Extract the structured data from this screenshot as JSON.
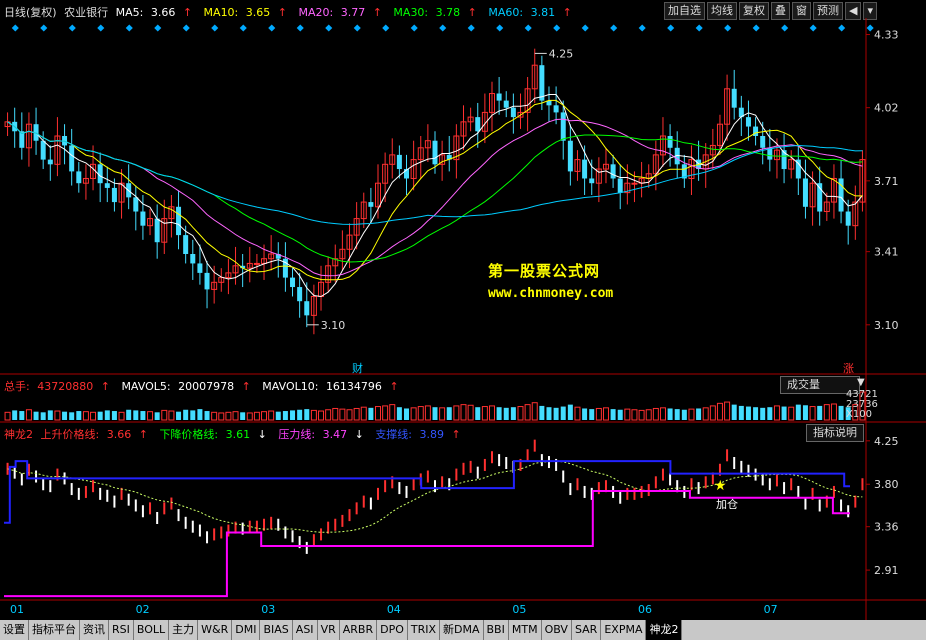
{
  "header": {
    "period": "日线(复权)",
    "stock": "农业银行",
    "ma5": {
      "label": "MA5:",
      "value": "3.66",
      "arrow": "↑",
      "color": "#ffffff"
    },
    "ma10": {
      "label": "MA10:",
      "value": "3.65",
      "arrow": "↑",
      "color": "#ffff00"
    },
    "ma20": {
      "label": "MA20:",
      "value": "3.77",
      "arrow": "↑",
      "color": "#ff66ff"
    },
    "ma30": {
      "label": "MA30:",
      "value": "3.78",
      "arrow": "↑",
      "color": "#00ff00"
    },
    "ma60": {
      "label": "MA60:",
      "value": "3.81",
      "arrow": "↑",
      "color": "#00ccff"
    }
  },
  "toolbar": {
    "add": "加自选",
    "ma": "均线",
    "adj": "复权",
    "overlay": "叠",
    "window": "窗",
    "forecast": "预测",
    "sound": "◀",
    "menu": "▾"
  },
  "watermark": {
    "line1": "第一股票公式网",
    "line2": "www.chnmoney.com"
  },
  "markers": {
    "cai": "财",
    "zhang": "涨"
  },
  "vol_header": {
    "label": "总手:",
    "value": "43720880",
    "arrow": "↑",
    "mavol5_label": "MAVOL5:",
    "mavol5": "20007978",
    "mavol5_arrow": "↑",
    "mavol10_label": "MAVOL10:",
    "mavol10": "16134796",
    "mavol10_arrow": "↑"
  },
  "vol_selector": "成交量",
  "vol_axis": {
    "top": "43721",
    "mid": "23736",
    "unit": "X100"
  },
  "ind_header": {
    "name": "神龙2",
    "l1_label": "上升价格线:",
    "l1": "3.66",
    "l1_arrow": "↑",
    "l2_label": "下降价格线:",
    "l2": "3.61",
    "l2_arrow": "↓",
    "l3_label": "压力线:",
    "l3": "3.47",
    "l3_arrow": "↓",
    "l4_label": "支撑线:",
    "l4": "3.89",
    "l4_arrow": "↑"
  },
  "ind_button": "指标说明",
  "ind_annotation": "加仓",
  "bottom_tabs": [
    "设置",
    "指标平台",
    "资讯",
    "RSI",
    "BOLL",
    "主力",
    "W&R",
    "DMI",
    "BIAS",
    "ASI",
    "VR",
    "ARBR",
    "DPO",
    "TRIX",
    "新DMA",
    "BBI",
    "MTM",
    "OBV",
    "SAR",
    "EXPMA",
    "神龙2"
  ],
  "bottom_selected": "神龙2",
  "chart_data": [
    {
      "type": "candlestick",
      "title": "",
      "ylim": [
        2.9,
        4.4
      ],
      "yticks": [
        3.1,
        3.41,
        3.71,
        4.02,
        4.33
      ],
      "xticks": [
        "01",
        "02",
        "03",
        "04",
        "05",
        "06",
        "07"
      ],
      "annotations": [
        {
          "label": "4.25",
          "value": 4.25
        },
        {
          "label": "3.10",
          "value": 3.1
        }
      ],
      "close": [
        3.96,
        3.92,
        3.85,
        3.95,
        3.88,
        3.8,
        3.78,
        3.9,
        3.86,
        3.75,
        3.7,
        3.72,
        3.78,
        3.7,
        3.68,
        3.62,
        3.7,
        3.64,
        3.58,
        3.52,
        3.55,
        3.45,
        3.55,
        3.6,
        3.48,
        3.4,
        3.36,
        3.32,
        3.25,
        3.28,
        3.3,
        3.32,
        3.35,
        3.34,
        3.36,
        3.36,
        3.38,
        3.4,
        3.38,
        3.3,
        3.26,
        3.2,
        3.14,
        3.22,
        3.28,
        3.35,
        3.38,
        3.42,
        3.48,
        3.55,
        3.62,
        3.6,
        3.7,
        3.78,
        3.82,
        3.76,
        3.72,
        3.8,
        3.85,
        3.88,
        3.78,
        3.82,
        3.8,
        3.9,
        3.96,
        3.98,
        3.92,
        4.0,
        4.08,
        4.05,
        4.02,
        3.98,
        4.0,
        4.1,
        4.2,
        4.05,
        4.03,
        4.0,
        3.88,
        3.75,
        3.8,
        3.72,
        3.7,
        3.76,
        3.78,
        3.72,
        3.66,
        3.7,
        3.7,
        3.72,
        3.74,
        3.82,
        3.9,
        3.85,
        3.78,
        3.72,
        3.8,
        3.76,
        3.82,
        3.86,
        3.95,
        4.1,
        4.02,
        3.98,
        3.94,
        3.9,
        3.85,
        3.8,
        3.84,
        3.76,
        3.8,
        3.72,
        3.6,
        3.7,
        3.58,
        3.62,
        3.72,
        3.58,
        3.52,
        3.62,
        3.8
      ],
      "ma_series": [
        {
          "name": "MA5",
          "color": "#ffffff"
        },
        {
          "name": "MA10",
          "color": "#ffff00"
        },
        {
          "name": "MA20",
          "color": "#ff66ff"
        },
        {
          "name": "MA30",
          "color": "#00ff00"
        },
        {
          "name": "MA60",
          "color": "#00ccff"
        }
      ]
    },
    {
      "type": "bar",
      "title": "",
      "ylim": [
        0,
        43721
      ],
      "values": [
        12000,
        15000,
        14000,
        16000,
        13000,
        12000,
        15000,
        14000,
        13000,
        12000,
        14000,
        13000,
        12000,
        13000,
        15000,
        14000,
        12000,
        16000,
        15000,
        14000,
        13000,
        12000,
        15000,
        14000,
        13000,
        16000,
        15000,
        17000,
        14000,
        12000,
        11000,
        12000,
        13000,
        12000,
        11000,
        12000,
        13000,
        14000,
        13000,
        14000,
        15000,
        16000,
        17000,
        15000,
        14000,
        16000,
        18000,
        17000,
        16000,
        18000,
        20000,
        19000,
        21000,
        22000,
        24000,
        20000,
        18000,
        19000,
        21000,
        22000,
        20000,
        19000,
        20000,
        22000,
        24000,
        23000,
        20000,
        21000,
        22000,
        20000,
        19000,
        20000,
        21000,
        24000,
        27000,
        22000,
        20000,
        19000,
        21000,
        24000,
        20000,
        18000,
        17000,
        18000,
        19000,
        17000,
        16000,
        17000,
        16000,
        15000,
        16000,
        18000,
        19000,
        18000,
        17000,
        16000,
        17000,
        18000,
        19000,
        22000,
        26000,
        28000,
        24000,
        22000,
        21000,
        20000,
        19000,
        20000,
        22000,
        21000,
        20000,
        24000,
        23000,
        21000,
        22000,
        24000,
        25000,
        22000,
        20000,
        24000,
        43721
      ]
    },
    {
      "type": "line",
      "title": "",
      "ylim": [
        2.6,
        4.3
      ],
      "yticks": [
        2.91,
        3.36,
        3.8,
        4.25
      ],
      "series": [
        {
          "name": "压力线",
          "color": "#ff00ff",
          "values": [
            2.64,
            2.64,
            2.64,
            2.64,
            2.64,
            2.64,
            2.64,
            2.64,
            2.64,
            2.64,
            2.64,
            2.64,
            2.64,
            2.64,
            2.64,
            2.64,
            2.64,
            2.64,
            2.64,
            2.64,
            2.64,
            2.64,
            2.64,
            2.64,
            2.64,
            2.64,
            2.64,
            2.64,
            2.64,
            2.64,
            2.64,
            2.64,
            2.64,
            2.64,
            2.64,
            2.64,
            2.64,
            2.64,
            2.64,
            3.3,
            3.3,
            3.3,
            3.3,
            3.3,
            3.3,
            3.16,
            3.16,
            3.16,
            3.16,
            3.16,
            3.16,
            3.16,
            3.16,
            3.16,
            3.16,
            3.16,
            3.16,
            3.16,
            3.16,
            3.16,
            3.16,
            3.16,
            3.16,
            3.16,
            3.16,
            3.16,
            3.16,
            3.16,
            3.16,
            3.16,
            3.16,
            3.16,
            3.16,
            3.16,
            3.16,
            3.16,
            3.16,
            3.16,
            3.16,
            3.16,
            3.16,
            3.16,
            3.16,
            3.16,
            3.16,
            3.16,
            3.16,
            3.16,
            3.16,
            3.16,
            3.16,
            3.16,
            3.16,
            3.16,
            3.16,
            3.16,
            3.16,
            3.16,
            3.16,
            3.16,
            3.16,
            3.16,
            3.16,
            3.73,
            3.73,
            3.73,
            3.73,
            3.73,
            3.73,
            3.73,
            3.73,
            3.73,
            3.73,
            3.73,
            3.73,
            3.73,
            3.73,
            3.73,
            3.73,
            3.73,
            3.66,
            3.66,
            3.66,
            3.66,
            3.66,
            3.66,
            3.66,
            3.66,
            3.66,
            3.66,
            3.66,
            3.66,
            3.66,
            3.66,
            3.66,
            3.66,
            3.66,
            3.66,
            3.66,
            3.66,
            3.66,
            3.66,
            3.66,
            3.66,
            3.66,
            3.5,
            3.5,
            3.5
          ]
        },
        {
          "name": "支撑线",
          "color": "#2222ff",
          "values": [
            3.4,
            3.98,
            4.04,
            4.04,
            3.86,
            3.86,
            3.86,
            3.86,
            3.86,
            3.86,
            3.86,
            3.86,
            3.86,
            3.86,
            3.86,
            3.86,
            3.86,
            3.86,
            3.86,
            3.86,
            3.86,
            3.86,
            3.86,
            3.86,
            3.86,
            3.86,
            3.86,
            3.86,
            3.86,
            3.86,
            3.86,
            3.86,
            3.86,
            3.86,
            3.86,
            3.86,
            3.86,
            3.86,
            3.86,
            3.86,
            3.86,
            3.86,
            3.86,
            3.86,
            3.86,
            3.86,
            3.86,
            3.86,
            3.86,
            3.86,
            3.86,
            3.86,
            3.86,
            3.86,
            3.86,
            3.86,
            3.86,
            3.86,
            3.86,
            3.86,
            3.86,
            3.86,
            3.86,
            3.86,
            3.86,
            3.86,
            3.86,
            3.86,
            3.86,
            3.86,
            3.86,
            3.86,
            3.76,
            3.76,
            3.76,
            3.76,
            3.76,
            3.76,
            3.76,
            3.76,
            3.76,
            3.76,
            3.76,
            3.76,
            3.76,
            3.76,
            3.76,
            3.76,
            4.04,
            4.04,
            4.04,
            4.04,
            4.04,
            4.04,
            4.04,
            4.04,
            4.04,
            4.04,
            4.04,
            4.04,
            4.04,
            4.04,
            4.04,
            4.04,
            4.04,
            4.04,
            4.04,
            4.04,
            4.04,
            4.04,
            4.04,
            4.04,
            4.04,
            4.04,
            4.04,
            3.91,
            3.91,
            3.91,
            3.91,
            3.91,
            3.91,
            3.91,
            3.91,
            3.91,
            3.91,
            3.91,
            3.91,
            3.91,
            3.91,
            3.91,
            3.91,
            3.91,
            3.91,
            3.91,
            3.91,
            3.91,
            3.91,
            3.91,
            3.91,
            3.91,
            3.91,
            3.91,
            3.91,
            3.91,
            3.91,
            3.78
          ]
        }
      ]
    }
  ]
}
